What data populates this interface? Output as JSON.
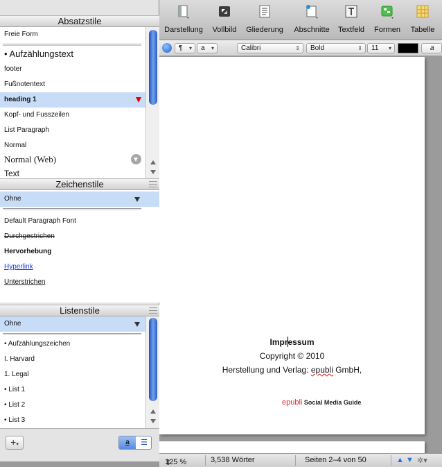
{
  "drawer": {
    "paragraph_styles": {
      "title": "Absatzstile",
      "items": [
        "Freie Form",
        "Aufzählungstext",
        "footer",
        "Fußnotentext",
        "heading 1",
        "Kopf- und Fusszeilen",
        "List Paragraph",
        "Normal",
        "Normal (Web)",
        "Text"
      ]
    },
    "character_styles": {
      "title": "Zeichenstile",
      "current": "Ohne",
      "items": [
        "Default Paragraph Font",
        "Durchgestrichen",
        "Hervorhebung",
        "Hyperlink",
        "Unterstrichen"
      ]
    },
    "list_styles": {
      "title": "Listenstile",
      "current": "Ohne",
      "items": [
        "Aufzählungszeichen",
        "I. Harvard",
        "1. Legal",
        "List 1",
        "List 2",
        "List 3"
      ]
    },
    "footer": {
      "add_label": "+",
      "view_left": "a",
      "view_right": "☰"
    }
  },
  "toolbar": {
    "buttons": [
      "Darstellung",
      "Vollbild",
      "Gliederung",
      "Abschnitte",
      "Textfeld",
      "Formen",
      "Tabelle"
    ]
  },
  "formatbar": {
    "paragraph_mark": "¶",
    "char_style": "a",
    "font": "Calibri",
    "weight": "Bold",
    "size": "11",
    "text_color": "#000000",
    "highlight_char": "a"
  },
  "document": {
    "title": "Impressum",
    "copyright": "Copyright © 2010",
    "publisher_prefix": "Herstellung und Verlag: ",
    "publisher_name": "epubli",
    "publisher_suffix": " GmbH,",
    "brand": "epubli",
    "brand_suffix": " Social Media Guide"
  },
  "status": {
    "zoom": "125 %",
    "word_count": "3,538 Wörter",
    "pages": "Seiten 2–4 von 50"
  },
  "colors": {
    "accent": "#c7dcf6",
    "brand_red": "#e2262f"
  }
}
